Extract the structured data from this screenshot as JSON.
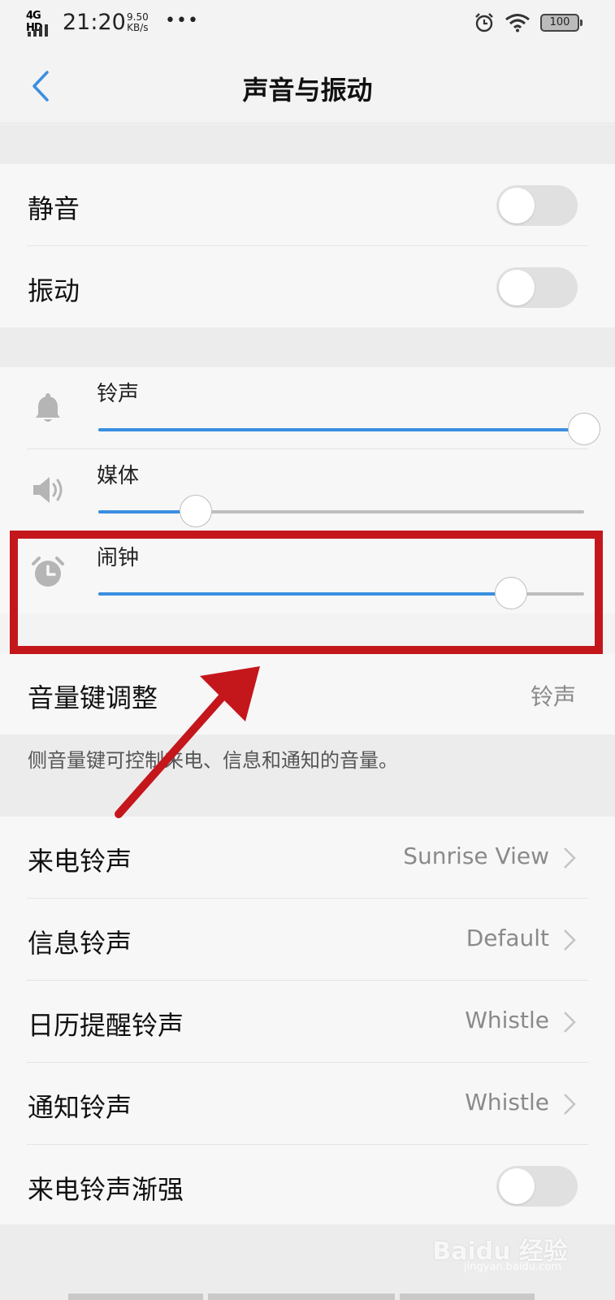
{
  "status_bar": {
    "network": "4G HD",
    "time": "21:20",
    "speed_value": "9.50",
    "speed_unit": "KB/s",
    "more": "•••",
    "battery": "100"
  },
  "header": {
    "title": "声音与振动"
  },
  "toggles": {
    "mute_label": "静音",
    "mute_on": false,
    "vibrate_label": "振动",
    "vibrate_on": false
  },
  "volume": {
    "ringtone_label": "铃声",
    "ringtone_level": 1.0,
    "media_label": "媒体",
    "media_level": 0.2,
    "alarm_label": "闹钟",
    "alarm_level": 0.85
  },
  "volume_key": {
    "label": "音量键调整",
    "value": "铃声",
    "hint": "侧音量键可控制来电、信息和通知的音量。"
  },
  "sounds": [
    {
      "label": "来电铃声",
      "value": "Sunrise View"
    },
    {
      "label": "信息铃声",
      "value": "Default"
    },
    {
      "label": "日历提醒铃声",
      "value": "Whistle"
    },
    {
      "label": "通知铃声",
      "value": "Whistle"
    }
  ],
  "crescendo": {
    "label": "来电铃声渐强",
    "on": false
  },
  "watermark": {
    "text": "Baidu 经验",
    "sub": "jingyan.baidu.com"
  },
  "colors": {
    "accent": "#3a8ee0",
    "annotation": "#c4171c"
  },
  "icons": {
    "back": "chevron-left-icon",
    "ringtone": "bell-icon",
    "media": "speaker-icon",
    "alarm": "alarm-clock-icon",
    "row_arrow": "chevron-right-icon"
  }
}
